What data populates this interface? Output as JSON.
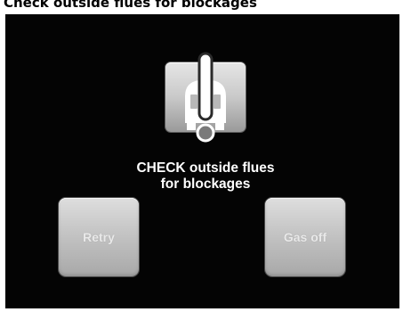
{
  "caption": "Check outside flues for blockages",
  "screen": {
    "icon": "boiler-warning-icon",
    "message_line1": "CHECK outside flues",
    "message_line2": "for blockages"
  },
  "buttons": {
    "retry_label": "Retry",
    "gas_off_label": "Gas off"
  }
}
